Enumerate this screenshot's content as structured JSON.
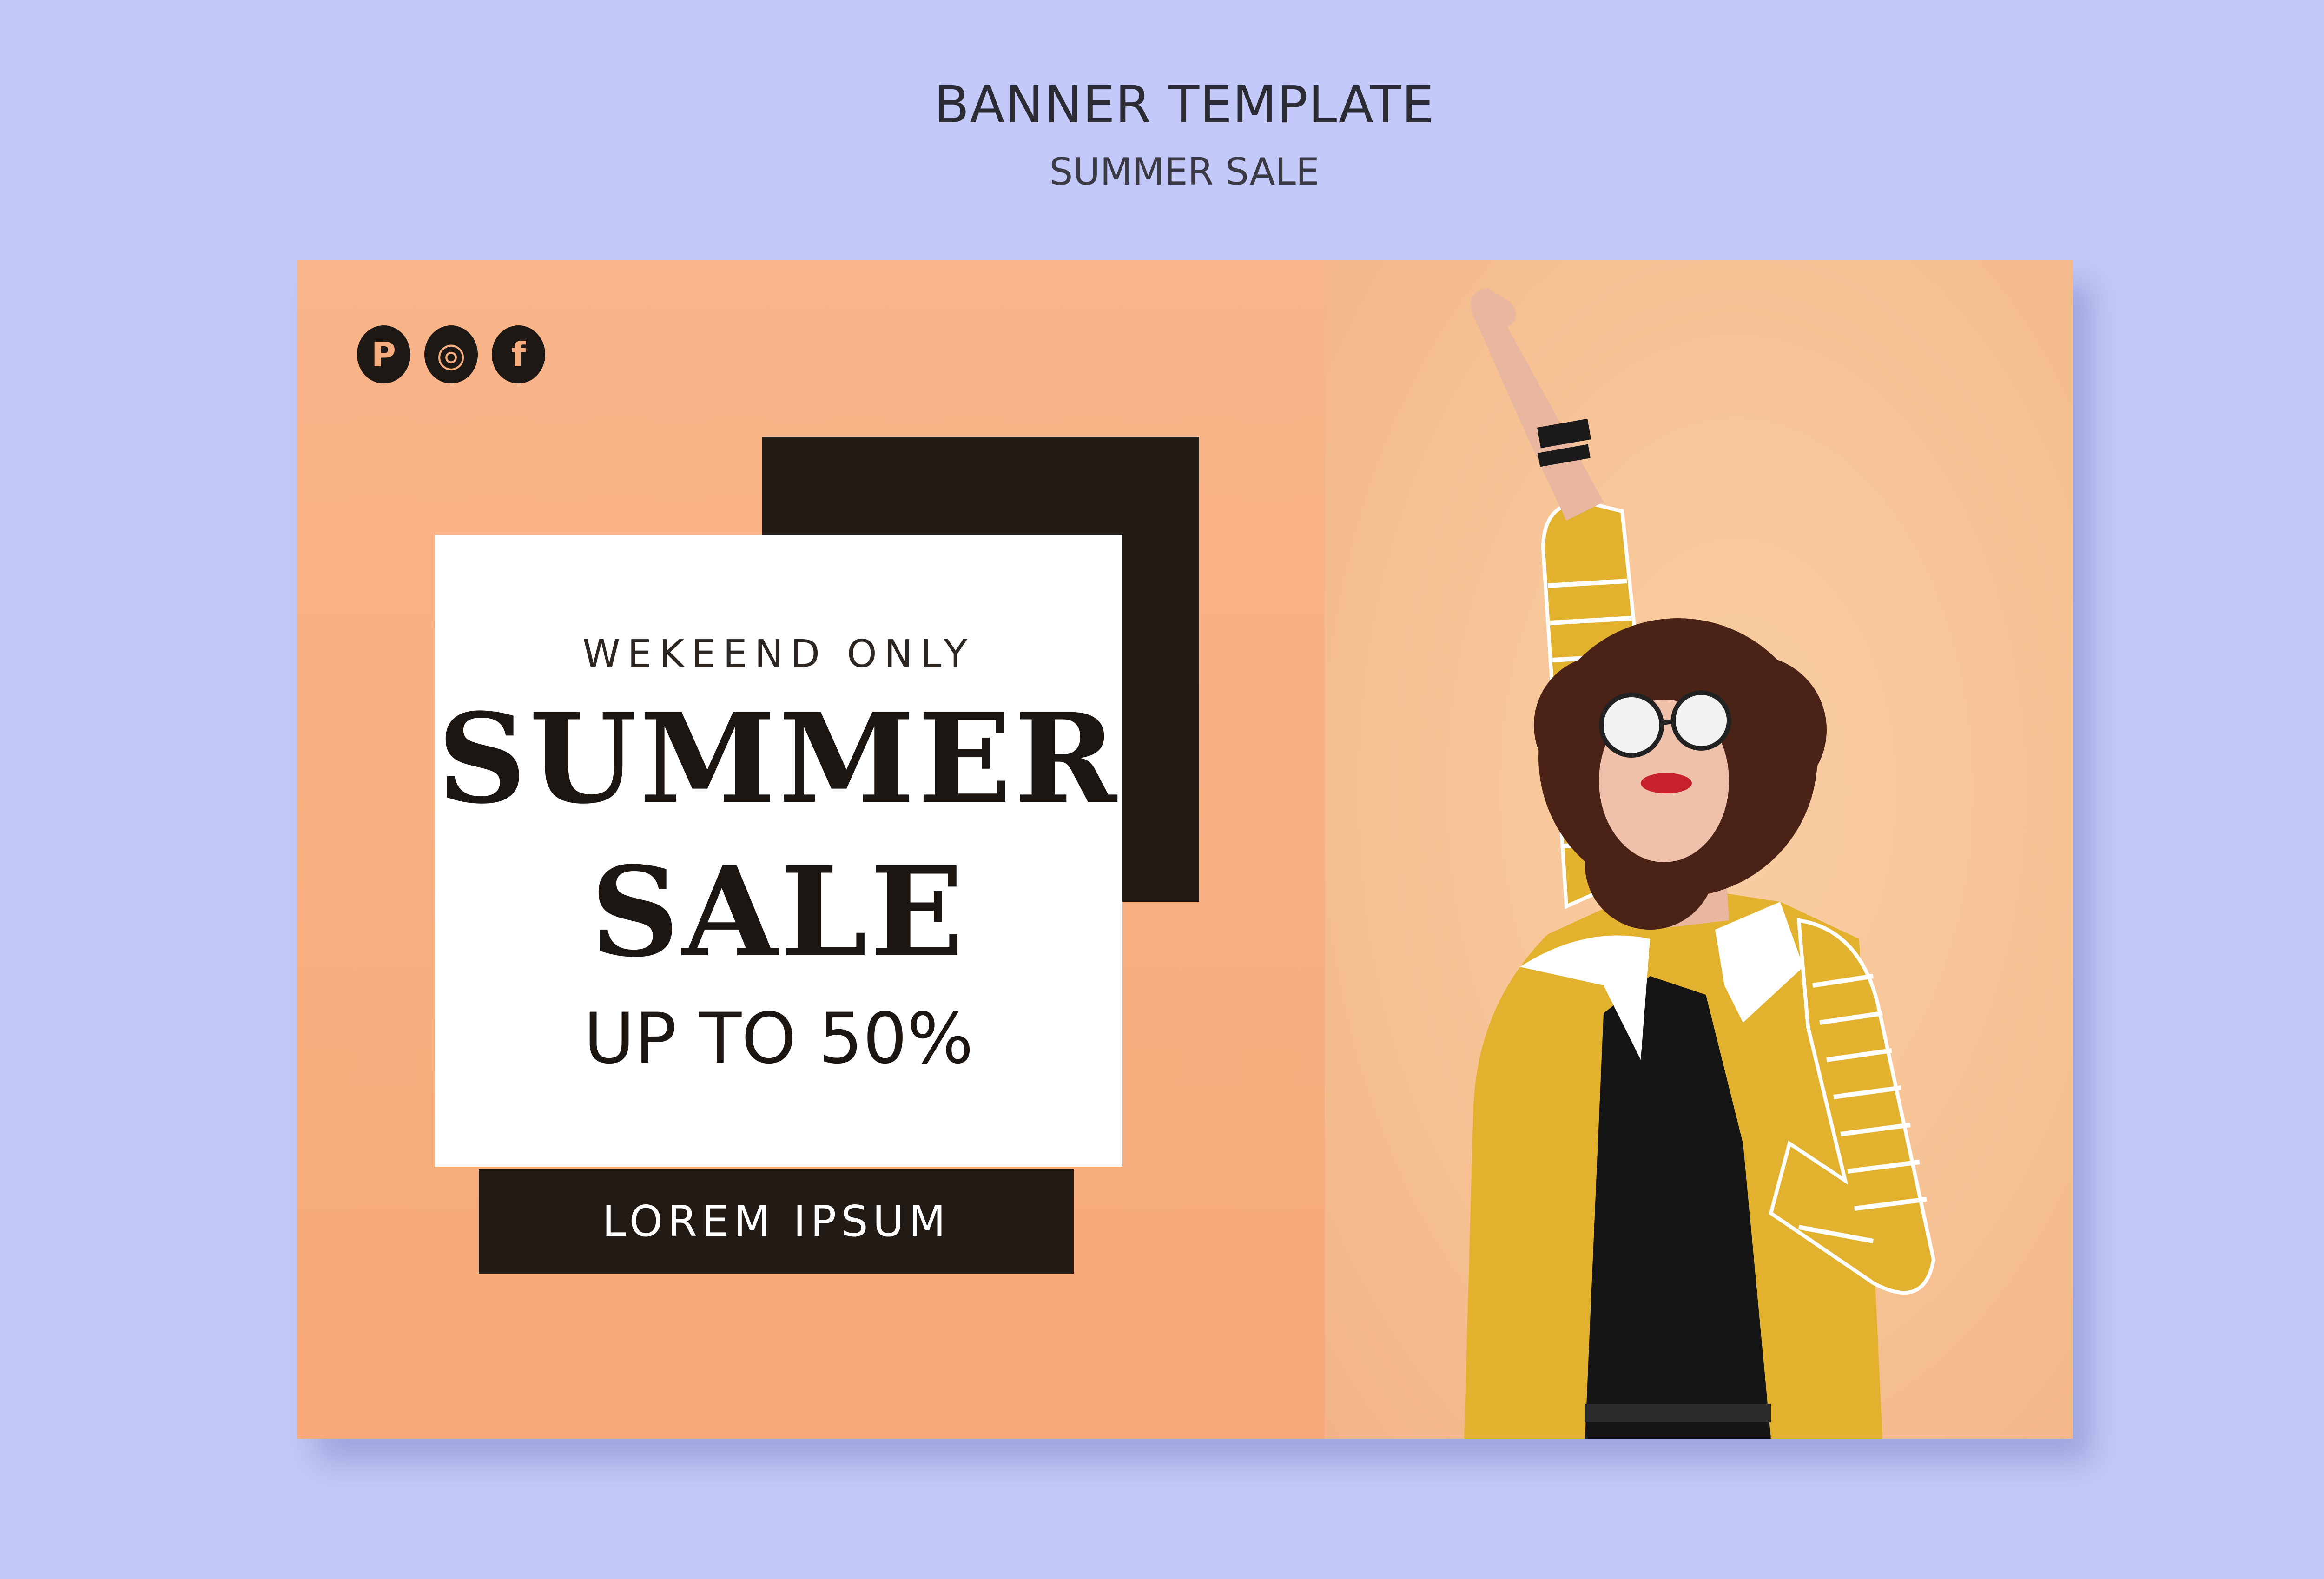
{
  "header": {
    "title": "BANNER TEMPLATE",
    "subtitle": "SUMMER SALE"
  },
  "banner": {
    "social_icons": [
      {
        "name": "pinterest-icon",
        "glyph": "P"
      },
      {
        "name": "instagram-icon",
        "glyph": "◎"
      },
      {
        "name": "facebook-icon",
        "glyph": "f"
      }
    ],
    "kicker": "WEKEEND ONLY",
    "headline_line1": "SUMMER",
    "headline_line2": "SALE",
    "discount": "UP TO 50%",
    "cta_label": "LOREM IPSUM"
  },
  "colors": {
    "page_background": "#c3c9f8",
    "left_panel": "#f7a977",
    "right_panel": "#f6c193",
    "dark_block": "#211a15",
    "jacket_yellow": "#e2b12d"
  }
}
